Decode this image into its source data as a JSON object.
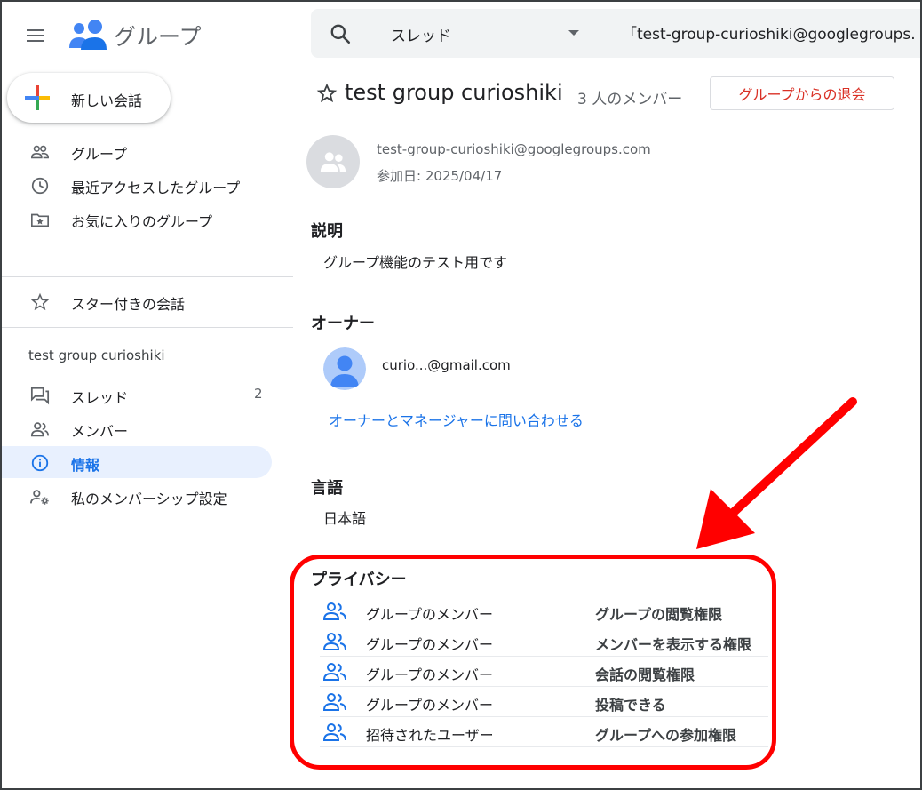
{
  "header": {
    "app_title": "グループ",
    "search_scope": "スレッド",
    "search_value": "「test-group-curioshiki@googlegroups."
  },
  "new_conversation": {
    "label": "新しい会話"
  },
  "sidebar": {
    "top_items": [
      {
        "label": "グループ",
        "icon": "groups-icon"
      },
      {
        "label": "最近アクセスしたグループ",
        "icon": "clock-icon"
      },
      {
        "label": "お気に入りのグループ",
        "icon": "star-folder-icon"
      }
    ],
    "starred_label": "スター付きの会話",
    "group_heading": "test group curioshiki",
    "group_items": [
      {
        "label": "スレッド",
        "icon": "threads-icon",
        "count": "2"
      },
      {
        "label": "メンバー",
        "icon": "members-icon"
      },
      {
        "label": "情報",
        "icon": "info-icon",
        "active": true
      },
      {
        "label": "私のメンバーシップ設定",
        "icon": "membership-settings-icon"
      }
    ]
  },
  "main": {
    "group_title": "test group curioshiki",
    "member_count": "3 人のメンバー",
    "leave_button": "グループからの退会",
    "group_email": "test-group-curioshiki@googlegroups.com",
    "join_date": "参加日: 2025/04/17",
    "description": {
      "title": "説明",
      "text": "グループ機能のテスト用です"
    },
    "owner": {
      "title": "オーナー",
      "email": "curio...@gmail.com",
      "contact_link": "オーナーとマネージャーに問い合わせる"
    },
    "language": {
      "title": "言語",
      "text": "日本語"
    },
    "privacy": {
      "title": "プライバシー",
      "rows": [
        {
          "who": "グループのメンバー",
          "what": "グループの閲覧権限"
        },
        {
          "who": "グループのメンバー",
          "what": "メンバーを表示する権限"
        },
        {
          "who": "グループのメンバー",
          "what": "会話の閲覧権限"
        },
        {
          "who": "グループのメンバー",
          "what": "投稿できる"
        },
        {
          "who": "招待されたユーザー",
          "what": "グループへの参加権限"
        }
      ]
    }
  },
  "colors": {
    "accent": "#1a73e8",
    "danger": "#d93025",
    "annotation": "#ff0000",
    "active_bg": "#e8f0fe"
  }
}
